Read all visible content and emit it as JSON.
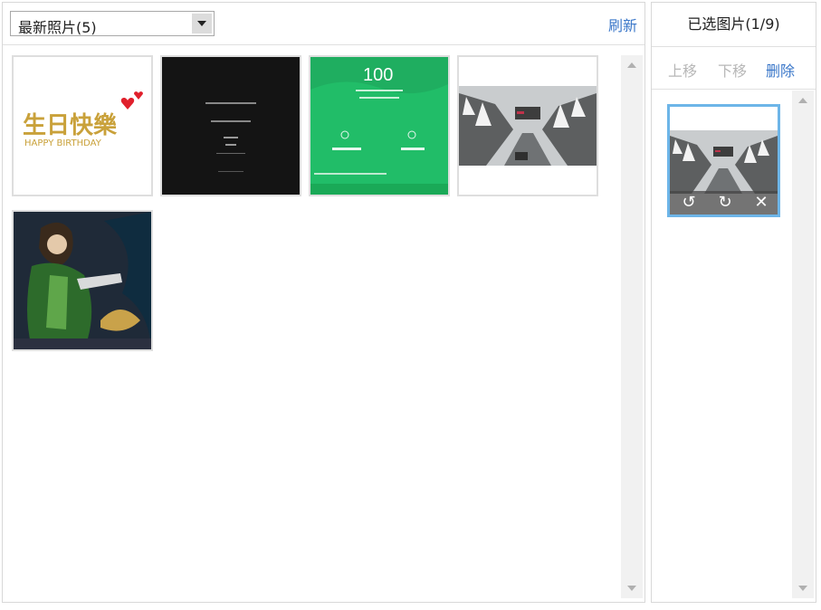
{
  "album_select": {
    "value": "最新照片(5)"
  },
  "refresh_label": "刷新",
  "thumbnails": [
    {
      "icon": "birthday-photo",
      "text_main": "生日快樂",
      "text_sub": "HAPPY BIRTHDAY"
    },
    {
      "icon": "dark-text-photo"
    },
    {
      "icon": "green-app-screenshot",
      "big_number": "100"
    },
    {
      "icon": "snow-road-photo"
    },
    {
      "icon": "anime-warrior-photo"
    }
  ],
  "right_panel": {
    "title": "已选图片(1/9)",
    "move_up_label": "上移",
    "move_down_label": "下移",
    "delete_label": "删除"
  },
  "selected_image": {
    "icon": "snow-road-photo"
  },
  "colors": {
    "link": "#3a77c9",
    "disabled": "#b7b7b7",
    "selected_border": "#6db5e8",
    "green": "#21bd68"
  }
}
